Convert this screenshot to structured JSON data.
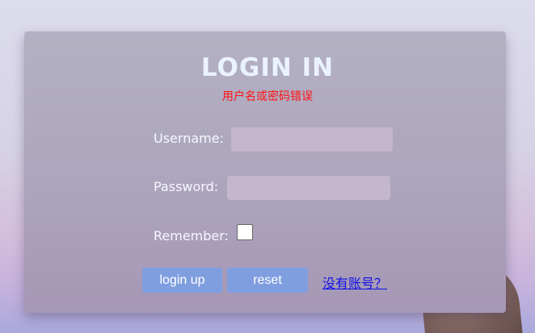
{
  "login": {
    "title": "LOGIN IN",
    "error_message": "用户名或密码错误",
    "username_label": "Username:",
    "username_value": "",
    "password_label": "Password:",
    "password_value": "",
    "remember_label": "Remember:",
    "remember_checked": false,
    "login_button": "login up",
    "reset_button": "reset",
    "register_link": "没有账号？"
  },
  "colors": {
    "title": "#eaf2ff",
    "error": "#ff1010",
    "button": "#7f9ee0",
    "input": "#c4b6cc",
    "link": "#1010e8"
  }
}
